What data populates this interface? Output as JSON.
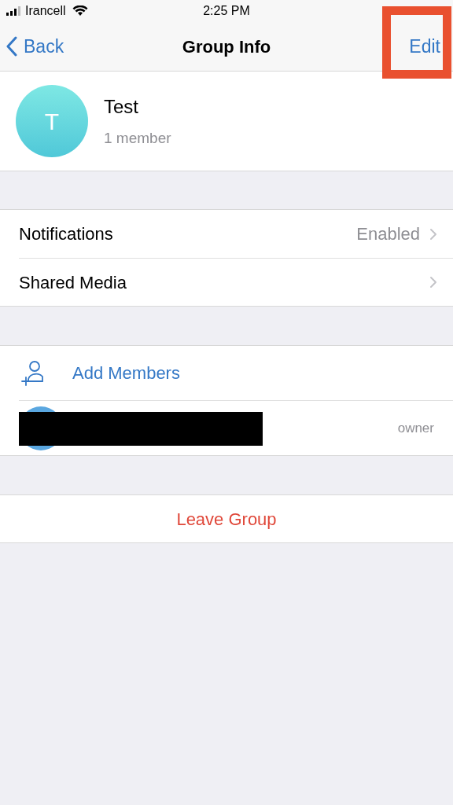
{
  "status_bar": {
    "carrier": "Irancell",
    "time": "2:25 PM"
  },
  "nav": {
    "back": "Back",
    "title": "Group Info",
    "edit": "Edit",
    "edit_highlighted": true
  },
  "group": {
    "initial": "T",
    "name": "Test",
    "members": "1 member"
  },
  "settings": [
    {
      "label": "Notifications",
      "value": "Enabled"
    },
    {
      "label": "Shared Media"
    }
  ],
  "add_members": "Add Members",
  "member": {
    "role": "owner",
    "redacted": true
  },
  "leave": "Leave Group"
}
